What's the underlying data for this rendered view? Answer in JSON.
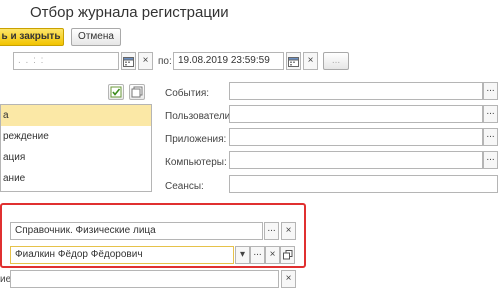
{
  "window": {
    "title": "Отбор журнала регистрации"
  },
  "toolbar": {
    "apply_close_label": "ь и закрыть",
    "cancel_label": "Отмена"
  },
  "period": {
    "from_placeholder": ". .   : :",
    "to_label": "по:",
    "to_value": "19.08.2019 23:59:59",
    "more_label": "..."
  },
  "levels": {
    "items": [
      "а",
      "реждение",
      "ация",
      "ание"
    ],
    "selected_index": 0
  },
  "filters": {
    "events_label": "События:",
    "users_label": "Пользователи:",
    "apps_label": "Приложения:",
    "computers_label": "Компьютеры:",
    "sessions_label": "Сеансы:"
  },
  "data_filter": {
    "metadata_value": "Справочник. Физические лица",
    "data_value": "Фиалкин Фёдор Фёдорович",
    "presentation_label": "ие",
    "presentation_value": ""
  },
  "icons": {
    "calendar": "calendar-icon",
    "clear": "×",
    "select": "...",
    "dropdown": "▾",
    "open": "open-icon"
  },
  "colors": {
    "primary_button": "#f2c400",
    "selected_row": "#fbe8a6",
    "highlight_border": "#e03030"
  }
}
